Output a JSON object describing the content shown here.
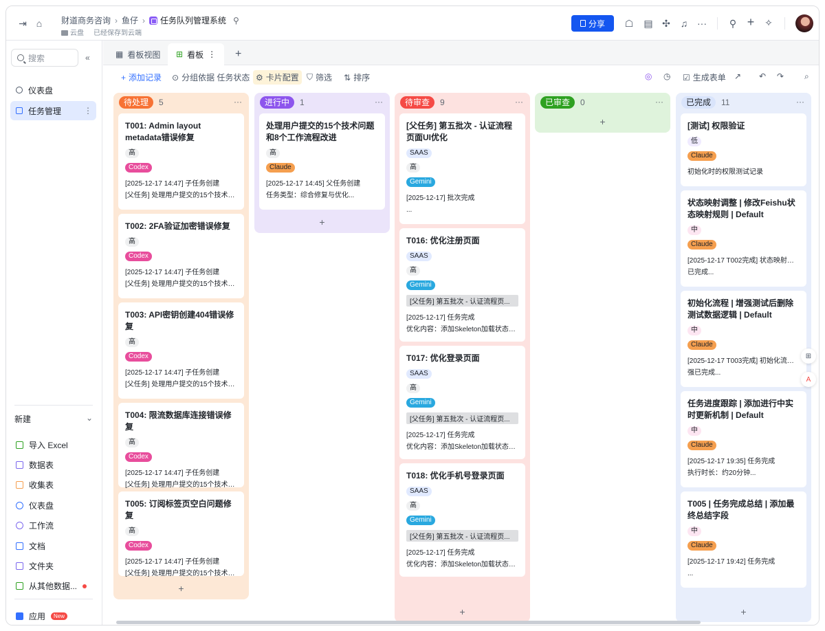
{
  "topbar": {
    "breadcrumb": [
      "财道商务咨询",
      "鱼仔",
      "任务队列管理系统"
    ],
    "location": "云盘",
    "save_status": "已经保存到云端",
    "share_label": "分享"
  },
  "sidebar": {
    "search_placeholder": "搜索",
    "items": [
      {
        "label": "仪表盘"
      },
      {
        "label": "任务管理",
        "more": "⋮"
      }
    ],
    "new_label": "新建",
    "create_items": [
      {
        "label": "导入 Excel",
        "color": "#2ea121"
      },
      {
        "label": "数据表",
        "color": "#7b67ee"
      },
      {
        "label": "收集表",
        "color": "#f59f4f"
      },
      {
        "label": "仪表盘",
        "color": "#3370ff"
      },
      {
        "label": "工作流",
        "color": "#7b67ee"
      },
      {
        "label": "文档",
        "color": "#3370ff"
      },
      {
        "label": "文件夹",
        "color": "#7b67ee"
      },
      {
        "label": "从其他数据...",
        "color": "#2ea121"
      }
    ],
    "apps_label": "应用",
    "apps_badge": "New"
  },
  "tabs": [
    {
      "label": "看板视图"
    },
    {
      "label": "看板",
      "more": "⋮"
    }
  ],
  "toolbar": {
    "add_record": "添加记录",
    "group_by": "分组依据 任务状态",
    "card_config": "卡片配置",
    "filter": "筛选",
    "sort": "排序",
    "generate_form": "生成表单"
  },
  "columns": [
    {
      "name": "待处理",
      "count": "5",
      "color": "#f77234",
      "bg": "#fde8d6",
      "cards": [
        {
          "title": "T001: Admin layout metadata错误修复",
          "tags": [
            {
              "t": "高",
              "c": "t-high"
            },
            {
              "t": "Codex",
              "c": "t-codex"
            }
          ],
          "lines": [
            "[2025-12-17 14:47] 子任务创建",
            "[父任务] 处理用户提交的15个技术问..."
          ]
        },
        {
          "title": "T002: 2FA验证加密错误修复",
          "tags": [
            {
              "t": "高",
              "c": "t-high"
            },
            {
              "t": "Codex",
              "c": "t-codex"
            }
          ],
          "lines": [
            "[2025-12-17 14:47] 子任务创建",
            "[父任务] 处理用户提交的15个技术问..."
          ]
        },
        {
          "title": "T003: API密钥创建404错误修复",
          "tags": [
            {
              "t": "高",
              "c": "t-high"
            },
            {
              "t": "Codex",
              "c": "t-codex"
            }
          ],
          "lines": [
            "[2025-12-17 14:47] 子任务创建",
            "[父任务] 处理用户提交的15个技术问..."
          ]
        },
        {
          "title": "T004: 限流数据库连接错误修复",
          "tags": [
            {
              "t": "高",
              "c": "t-high"
            },
            {
              "t": "Codex",
              "c": "t-codex"
            }
          ],
          "lines": [
            "[2025-12-17 14:47] 子任务创建",
            "[父任务] 处理用户提交的15个技术问..."
          ]
        },
        {
          "title": "T005: 订阅标签页空白问题修复",
          "tags": [
            {
              "t": "高",
              "c": "t-high"
            },
            {
              "t": "Codex",
              "c": "t-codex"
            }
          ],
          "lines": [
            "[2025-12-17 14:47] 子任务创建",
            "[父任务] 处理用户提交的15个技术问..."
          ]
        }
      ]
    },
    {
      "name": "进行中",
      "count": "1",
      "color": "#8d55ed",
      "bg": "#ebe4fa",
      "cards": [
        {
          "title": "处理用户提交的15个技术问题和8个工作流程改进",
          "tags": [
            {
              "t": "高",
              "c": "t-high"
            },
            {
              "t": "Claude",
              "c": "t-claude"
            }
          ],
          "lines": [
            "[2025-12-17 14:45] 父任务创建",
            "任务类型：综合修复与优化..."
          ]
        }
      ]
    },
    {
      "name": "待审查",
      "count": "9",
      "color": "#f54a45",
      "bg": "#fde2e0",
      "cards": [
        {
          "title": "[父任务] 第五批次 - 认证流程页面UI优化",
          "tags": [
            {
              "t": "SAAS",
              "c": "t-saas"
            },
            {
              "t": "高",
              "c": "t-high"
            },
            {
              "t": "Gemini",
              "c": "t-gemini"
            }
          ],
          "lines": [
            "[2025-12-17] 批次完成",
            "..."
          ]
        },
        {
          "title": "T016: 优化注册页面",
          "tags": [
            {
              "t": "SAAS",
              "c": "t-saas"
            },
            {
              "t": "高",
              "c": "t-high"
            },
            {
              "t": "Gemini",
              "c": "t-gemini"
            }
          ],
          "parent": "[父任务] 第五批次 - 认证流程页...",
          "lines": [
            "[2025-12-17] 任务完成",
            "优化内容：添加Skeleton加载状态、..."
          ]
        },
        {
          "title": "T017: 优化登录页面",
          "tags": [
            {
              "t": "SAAS",
              "c": "t-saas"
            },
            {
              "t": "高",
              "c": "t-high"
            },
            {
              "t": "Gemini",
              "c": "t-gemini"
            }
          ],
          "parent": "[父任务] 第五批次 - 认证流程页...",
          "lines": [
            "[2025-12-17] 任务完成",
            "优化内容：添加Skeleton加载状态、..."
          ]
        },
        {
          "title": "T018: 优化手机号登录页面",
          "tags": [
            {
              "t": "SAAS",
              "c": "t-saas"
            },
            {
              "t": "高",
              "c": "t-high"
            },
            {
              "t": "Gemini",
              "c": "t-gemini"
            }
          ],
          "parent": "[父任务] 第五批次 - 认证流程页...",
          "lines": [
            "[2025-12-17] 任务完成",
            "优化内容：添加Skeleton加载状态、..."
          ]
        }
      ]
    },
    {
      "name": "已审查",
      "count": "0",
      "color": "#2ea121",
      "bg": "#dff3dc",
      "cards": []
    },
    {
      "name": "已完成",
      "count": "11",
      "color": "#d9e4fb",
      "bg": "#e8eefb",
      "dark": true,
      "cards": [
        {
          "title": "[测试] 权限验证",
          "tags": [
            {
              "t": "低",
              "c": "t-low"
            },
            {
              "t": "Claude",
              "c": "t-claude"
            }
          ],
          "lines": [
            "初始化时的权限测试记录"
          ]
        },
        {
          "title": "状态映射调整 | 修改Feishu状态映射规则 | Default",
          "tags": [
            {
              "t": "中",
              "c": "t-mid"
            },
            {
              "t": "Claude",
              "c": "t-claude"
            }
          ],
          "lines": [
            "[2025-12-17 T002完成] 状态映射调整",
            "已完成..."
          ]
        },
        {
          "title": "初始化流程 | 增强测试后删除测试数据逻辑 | Default",
          "tags": [
            {
              "t": "中",
              "c": "t-mid"
            },
            {
              "t": "Claude",
              "c": "t-claude"
            }
          ],
          "lines": [
            "[2025-12-17 T003完成] 初始化流程增",
            "强已完成..."
          ]
        },
        {
          "title": "任务进度跟踪 | 添加进行中实时更新机制 | Default",
          "tags": [
            {
              "t": "中",
              "c": "t-mid"
            },
            {
              "t": "Claude",
              "c": "t-claude"
            }
          ],
          "lines": [
            "[2025-12-17 19:35] 任务完成",
            "执行时长：约20分钟..."
          ]
        },
        {
          "title": "T005 | 任务完成总结 | 添加最终总结字段",
          "tags": [
            {
              "t": "中",
              "c": "t-mid"
            },
            {
              "t": "Claude",
              "c": "t-claude"
            }
          ],
          "lines": [
            "[2025-12-17 19:42] 任务完成",
            "..."
          ]
        }
      ]
    }
  ],
  "add_label": "+",
  "col_more": "···"
}
